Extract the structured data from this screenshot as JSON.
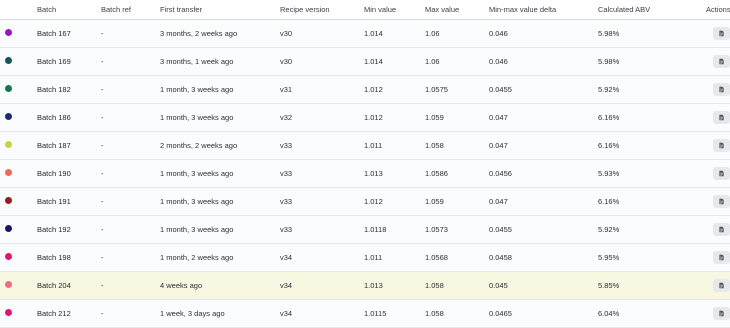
{
  "table": {
    "headers": {
      "batch": "Batch",
      "batch_ref": "Batch ref",
      "first_transfer": "First transfer",
      "recipe_version": "Recipe version",
      "min_value": "Min value",
      "max_value": "Max value",
      "delta": "Min-max value delta",
      "abv": "Calculated ABV",
      "actions": "Actions"
    },
    "action_icon": "document-icon",
    "rows": [
      {
        "color": "#9b13c9",
        "batch": "Batch 167",
        "batch_ref": "-",
        "first_transfer": "3 months, 2 weeks ago",
        "recipe_version": "v30",
        "min_value": "1.014",
        "max_value": "1.06",
        "delta": "0.046",
        "abv": "5.98%",
        "highlighted": false
      },
      {
        "color": "#0f5a55",
        "batch": "Batch 169",
        "batch_ref": "-",
        "first_transfer": "3 months, 1 week ago",
        "recipe_version": "v30",
        "min_value": "1.014",
        "max_value": "1.06",
        "delta": "0.046",
        "abv": "5.98%",
        "highlighted": false
      },
      {
        "color": "#0f7a4a",
        "batch": "Batch 182",
        "batch_ref": "-",
        "first_transfer": "1 month, 3 weeks ago",
        "recipe_version": "v31",
        "min_value": "1.012",
        "max_value": "1.0575",
        "delta": "0.0455",
        "abv": "5.92%",
        "highlighted": false
      },
      {
        "color": "#1e2a6e",
        "batch": "Batch 186",
        "batch_ref": "-",
        "first_transfer": "1 month, 3 weeks ago",
        "recipe_version": "v32",
        "min_value": "1.012",
        "max_value": "1.059",
        "delta": "0.047",
        "abv": "6.16%",
        "highlighted": false
      },
      {
        "color": "#c8d43a",
        "batch": "Batch 187",
        "batch_ref": "-",
        "first_transfer": "2 months, 2 weeks ago",
        "recipe_version": "v33",
        "min_value": "1.011",
        "max_value": "1.058",
        "delta": "0.047",
        "abv": "6.16%",
        "highlighted": false
      },
      {
        "color": "#ee6a55",
        "batch": "Batch 190",
        "batch_ref": "-",
        "first_transfer": "1 month, 3 weeks ago",
        "recipe_version": "v33",
        "min_value": "1.013",
        "max_value": "1.0586",
        "delta": "0.0456",
        "abv": "5.93%",
        "highlighted": false
      },
      {
        "color": "#9a1c1c",
        "batch": "Batch 191",
        "batch_ref": "-",
        "first_transfer": "1 month, 3 weeks ago",
        "recipe_version": "v33",
        "min_value": "1.012",
        "max_value": "1.059",
        "delta": "0.047",
        "abv": "6.16%",
        "highlighted": false
      },
      {
        "color": "#1b1560",
        "batch": "Batch 192",
        "batch_ref": "-",
        "first_transfer": "1 month, 3 weeks ago",
        "recipe_version": "v33",
        "min_value": "1.0118",
        "max_value": "1.0573",
        "delta": "0.0455",
        "abv": "5.92%",
        "highlighted": false
      },
      {
        "color": "#e0157a",
        "batch": "Batch 198",
        "batch_ref": "-",
        "first_transfer": "1 month, 2 weeks ago",
        "recipe_version": "v34",
        "min_value": "1.011",
        "max_value": "1.0568",
        "delta": "0.0458",
        "abv": "5.95%",
        "highlighted": false
      },
      {
        "color": "#f26d7d",
        "batch": "Batch 204",
        "batch_ref": "-",
        "first_transfer": "4 weeks ago",
        "recipe_version": "v34",
        "min_value": "1.013",
        "max_value": "1.058",
        "delta": "0.045",
        "abv": "5.85%",
        "highlighted": true
      },
      {
        "color": "#e0157a",
        "batch": "Batch 212",
        "batch_ref": "-",
        "first_transfer": "1 week, 3 days ago",
        "recipe_version": "v34",
        "min_value": "1.0115",
        "max_value": "1.058",
        "delta": "0.0465",
        "abv": "6.04%",
        "highlighted": false
      }
    ]
  }
}
